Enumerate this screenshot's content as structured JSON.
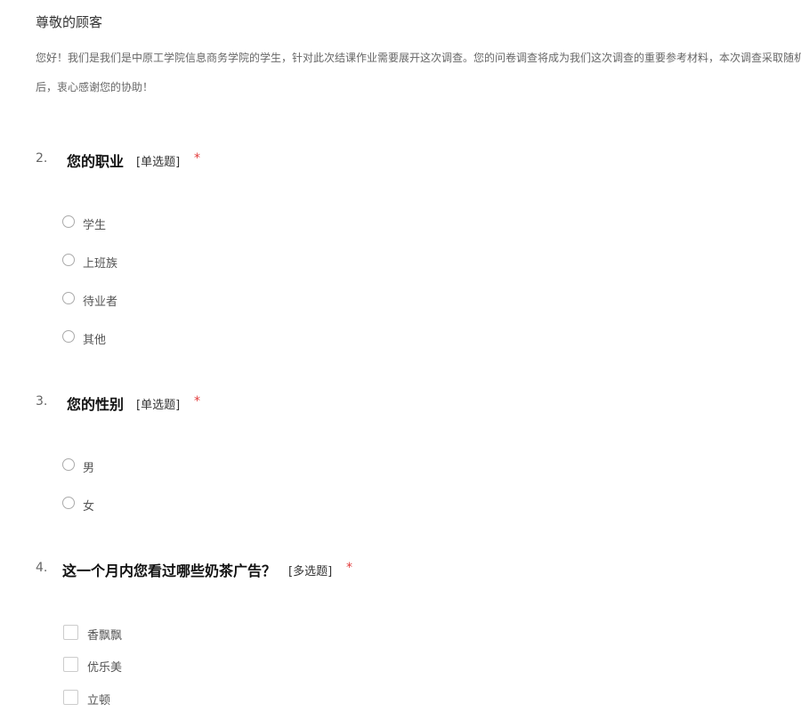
{
  "header": {
    "greeting": "尊敬的顾客",
    "intro_line1": "您好！我们是我们是中原工学院信息商务学院的学生，针对此次结课作业需要展开这次调查。您的问卷调查将成为我们这次调查的重要参考材料，本次调查采取随机",
    "intro_line2": "后，衷心感谢您的协助！"
  },
  "questions": [
    {
      "number": "2.",
      "title": "您的职业",
      "type": "[单选题]",
      "required": "*",
      "options": [
        "学生",
        "上班族",
        "待业者",
        "其他"
      ]
    },
    {
      "number": "3.",
      "title": "您的性别",
      "type": "[单选题]",
      "required": "*",
      "options": [
        "男",
        "女"
      ]
    },
    {
      "number": "4.",
      "title": "这一个月内您看过哪些奶茶广告？",
      "type": "[多选题]",
      "required": "*",
      "options": [
        "香飘飘",
        "优乐美",
        "立顿"
      ]
    }
  ]
}
